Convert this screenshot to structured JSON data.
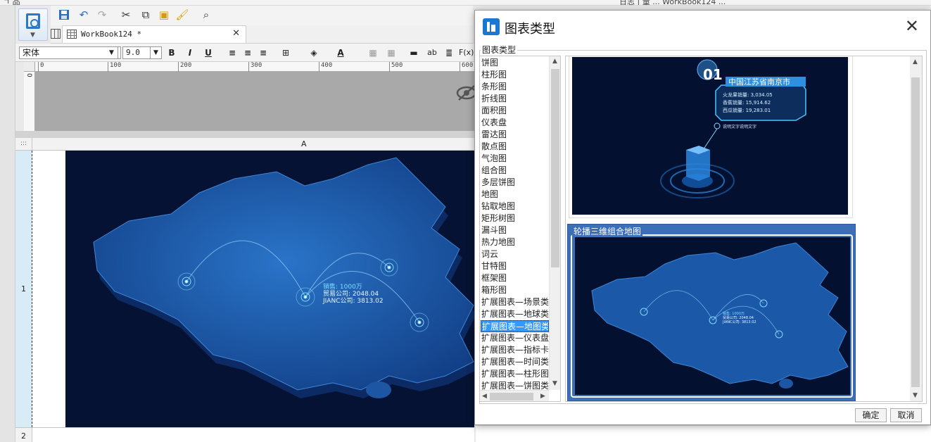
{
  "topbar": {
    "left_text_1": "ㄱ 品",
    "left_text_2": "tiny",
    "right_text": "日志 | 量 ... WorkBook124 ..."
  },
  "tab": {
    "label": "WorkBook124 *"
  },
  "format": {
    "font_name": "宋体",
    "font_size": "9.0",
    "bold": "B",
    "italic": "I",
    "underline": "U",
    "fx": "F(x)",
    "ab": "ab"
  },
  "ruler": {
    "ticks": [
      "0",
      "100",
      "200",
      "300",
      "400",
      "500",
      "600"
    ],
    "v_tick": "0"
  },
  "sheet": {
    "col_a": "A",
    "row_1": "1",
    "row_2": "2",
    "corner": ":::"
  },
  "map": {
    "label_line1": "销售: 1000万",
    "label_line2": "贸易公司: 2048.04",
    "label_line3": "JIANC公司: 3813.02"
  },
  "dialog": {
    "title": "图表类型",
    "group_label": "图表类型",
    "chart_types": [
      "饼图",
      "柱形图",
      "条形图",
      "折线图",
      "面积图",
      "仪表盘",
      "雷达图",
      "散点图",
      "气泡图",
      "组合图",
      "多层饼图",
      "地图",
      "钻取地图",
      "矩形树图",
      "漏斗图",
      "热力地图",
      "词云",
      "甘特图",
      "框架图",
      "箱形图",
      "扩展图表—场景类",
      "扩展图表—地球类",
      "扩展图表—地图类",
      "扩展图表—仪表盘",
      "扩展图表—指标卡",
      "扩展图表—时间类",
      "扩展图表—柱形图",
      "扩展图表—饼图类"
    ],
    "selected_index": 22,
    "card1": {
      "badge": "01",
      "heading": "中国江苏省南京市",
      "rows": [
        "火龙果销量: 3,034.05",
        "香蕉销量: 15,914.62",
        "西瓜销量: 19,283.01"
      ],
      "note": "说明文字说明文字"
    },
    "card2": {
      "label": "轮播三维组合地图",
      "l1": "销售: 1000万",
      "l2": "贸易公司: 2048.04",
      "l3": "JIANC公司: 3813.02"
    },
    "ok_label": "确定",
    "cancel_label": "取消"
  },
  "colors": {
    "accent": "#3399ff",
    "map_bg": "#061233",
    "map_land": "#1b58a8",
    "selected_card": "#3d6fb8"
  }
}
